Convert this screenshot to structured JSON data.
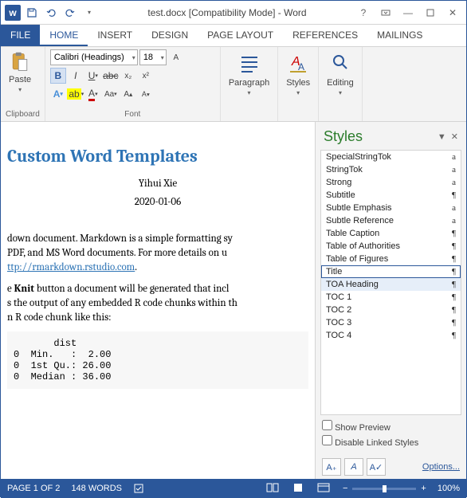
{
  "title": "test.docx [Compatibility Mode] - Word",
  "tabs": {
    "file": "FILE",
    "home": "HOME",
    "insert": "INSERT",
    "design": "DESIGN",
    "layout": "PAGE LAYOUT",
    "refs": "REFERENCES",
    "mailings": "MAILINGS"
  },
  "ribbon": {
    "clipboard": {
      "paste": "Paste",
      "label": "Clipboard"
    },
    "font": {
      "name": "Calibri (Headings)",
      "size": "18",
      "label": "Font"
    },
    "paragraph": "Paragraph",
    "styles": "Styles",
    "editing": "Editing"
  },
  "doc": {
    "h1": "Custom Word Templates",
    "author": "Yihui Xie",
    "date": "2020-01-06",
    "p1a": "down document. Markdown is a simple formatting sy",
    "p1b": " PDF, and MS Word documents. For more details on u ",
    "link": "ttp://rmarkdown.rstudio.com",
    "p2a": "e ",
    "p2knit": "Knit",
    "p2b": " button a document will be generated that incl",
    "p2c": "s the output of any embedded R code chunks within th",
    "p2d": "n R code chunk like this:",
    "code": "       dist\n0  Min.   :  2.00\n0  1st Qu.: 26.00\n0  Median : 36.00"
  },
  "stylesPane": {
    "title": "Styles",
    "items": [
      {
        "n": "SpecialStringTok",
        "m": "a"
      },
      {
        "n": "StringTok",
        "m": "a"
      },
      {
        "n": "Strong",
        "m": "a"
      },
      {
        "n": "Subtitle",
        "m": "¶"
      },
      {
        "n": "Subtle Emphasis",
        "m": "a"
      },
      {
        "n": "Subtle Reference",
        "m": "a"
      },
      {
        "n": "Table Caption",
        "m": "¶"
      },
      {
        "n": "Table of Authorities",
        "m": "¶"
      },
      {
        "n": "Table of Figures",
        "m": "¶"
      },
      {
        "n": "Title",
        "m": "¶",
        "sel": true
      },
      {
        "n": "TOA Heading",
        "m": "¶",
        "hl": true
      },
      {
        "n": "TOC 1",
        "m": "¶"
      },
      {
        "n": "TOC 2",
        "m": "¶"
      },
      {
        "n": "TOC 3",
        "m": "¶"
      },
      {
        "n": "TOC 4",
        "m": "¶"
      }
    ],
    "showPreview": "Show Preview",
    "disableLinked": "Disable Linked Styles",
    "options": "Options..."
  },
  "status": {
    "page": "PAGE 1 OF 2",
    "words": "148 WORDS",
    "zoom": "100%"
  }
}
